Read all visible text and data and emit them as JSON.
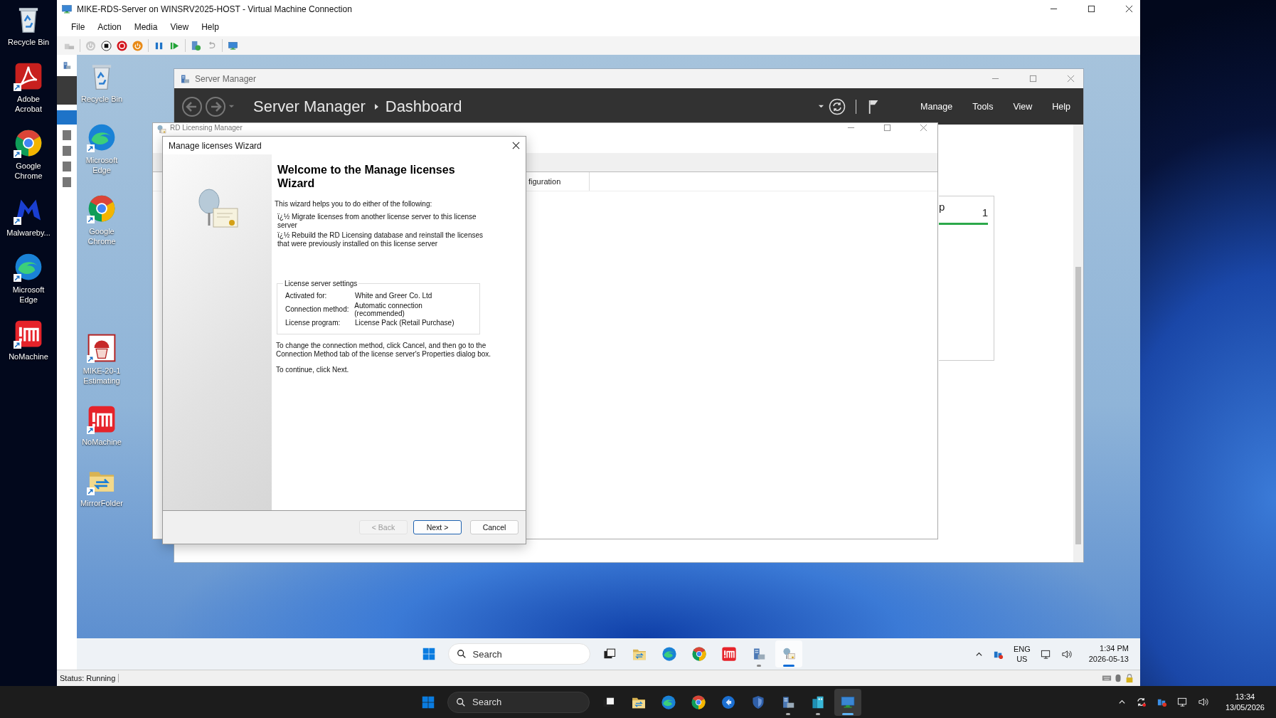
{
  "host_desktop": {
    "icons": [
      {
        "label": "Recycle Bin",
        "shortcut": false
      },
      {
        "label": "Adobe Acrobat",
        "shortcut": true
      },
      {
        "label": "Google Chrome",
        "shortcut": true
      },
      {
        "label": "Malwareby...",
        "shortcut": true
      },
      {
        "label": "Microsoft Edge",
        "shortcut": true
      },
      {
        "label": "NoMachine",
        "shortcut": true
      }
    ]
  },
  "vm_window": {
    "title": "MIKE-RDS-Server on WINSRV2025-HOST - Virtual Machine Connection",
    "menu": [
      "File",
      "Action",
      "Media",
      "View",
      "Help"
    ],
    "status": "Status: Running"
  },
  "guest_desktop": {
    "icons": [
      {
        "label": "Recycle Bin",
        "shortcut": false
      },
      {
        "label": "Microsoft Edge",
        "shortcut": true
      },
      {
        "label": "Google Chrome",
        "shortcut": true
      },
      {
        "label": "MIKE-20-1 Estimating",
        "shortcut": true
      },
      {
        "label": "NoMachine",
        "shortcut": true
      },
      {
        "label": "MirrorFolder",
        "shortcut": true
      }
    ]
  },
  "server_manager": {
    "title": "Server Manager",
    "breadcrumb": [
      "Server Manager",
      "Dashboard"
    ],
    "menu": [
      "Manage",
      "Tools",
      "View",
      "Help"
    ],
    "tile": {
      "label": "p",
      "count": "1"
    }
  },
  "rd_licensing_manager": {
    "title": "RD Licensing Manager",
    "column_1": "figuration"
  },
  "wizard": {
    "title": "Manage licenses Wizard",
    "heading": "Welcome to the Manage licenses Wizard",
    "intro": "This wizard helps you to do either of the following:",
    "bullets": [
      "ï¿½ Migrate licenses from another license server to this license server",
      "ï¿½ Rebuild the RD Licensing database and reinstall the licenses that were previously installed on this license server"
    ],
    "settings": {
      "title": "License server settings",
      "rows": [
        {
          "label": "Activated for:",
          "value": "White and Greer Co. Ltd"
        },
        {
          "label": "Connection method:",
          "value": "Automatic connection (recommended)"
        },
        {
          "label": "License program:",
          "value": "License Pack (Retail Purchase)"
        }
      ]
    },
    "note": "To change the connection method, click Cancel, and then go to the Connection Method tab of the license server's Properties dialog box.",
    "continue": "To continue, click Next.",
    "buttons": [
      {
        "label": "< Back",
        "disabled": true,
        "default": false
      },
      {
        "label": "Next >",
        "disabled": false,
        "default": true
      },
      {
        "label": "Cancel",
        "disabled": false,
        "default": false
      }
    ]
  },
  "guest_taskbar": {
    "search_placeholder": "Search",
    "apps": [
      {
        "running": false,
        "selected": false
      },
      {
        "running": false,
        "selected": false
      },
      {
        "running": false,
        "selected": false
      },
      {
        "running": false,
        "selected": false
      },
      {
        "running": false,
        "selected": false
      },
      {
        "running": true,
        "selected": false
      },
      {
        "running": true,
        "selected": true
      }
    ],
    "language": [
      "ENG",
      "US"
    ],
    "time": "1:34 PM",
    "date": "2026-05-13"
  },
  "host_taskbar": {
    "search_placeholder": "Search",
    "apps": [
      {
        "running": false,
        "selected": false
      },
      {
        "running": false,
        "selected": false
      },
      {
        "running": false,
        "selected": false
      },
      {
        "running": false,
        "selected": false
      },
      {
        "running": false,
        "selected": false
      },
      {
        "running": false,
        "selected": false
      },
      {
        "running": true,
        "selected": false
      },
      {
        "running": true,
        "selected": false
      },
      {
        "running": true,
        "selected": true
      }
    ],
    "time": "13:34",
    "date": "13/05/2026"
  }
}
